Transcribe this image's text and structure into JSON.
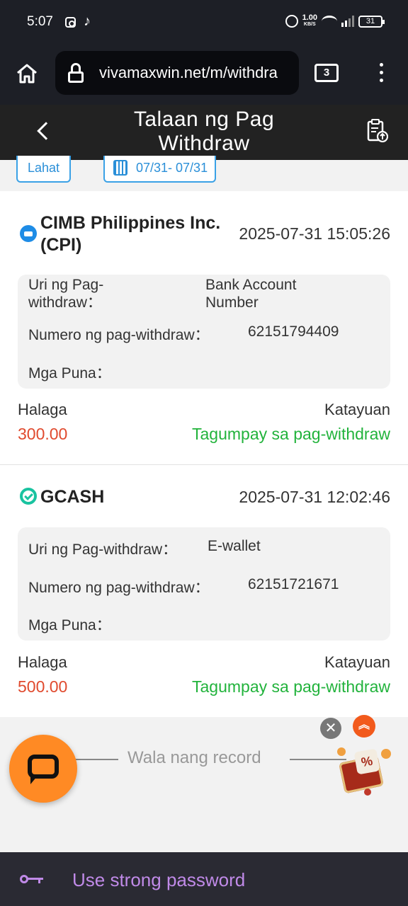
{
  "status_bar": {
    "time": "5:07",
    "net_speed": "1.00",
    "net_unit": "KB/S",
    "battery": "31"
  },
  "browser": {
    "url": "vivamaxwin.net/m/withdra",
    "tab_count": "3"
  },
  "header": {
    "title": "Talaan ng Pag Withdraw"
  },
  "filters": {
    "all_label": "Lahat",
    "date_range": "07/31- 07/31"
  },
  "records": [
    {
      "bank": "CIMB Philippines Inc. (CPI)",
      "datetime": "2025-07-31 15:05:26",
      "type_label": "Uri ng Pag-withdraw：",
      "type_value": "Bank Account Number",
      "number_label": "Numero ng pag-withdraw：",
      "number_value": "62151794409",
      "remarks_label": "Mga Puna：",
      "amount_label": "Halaga",
      "amount": "300.00",
      "status_label": "Katayuan",
      "status": "Tagumpay sa pag-withdraw"
    },
    {
      "bank": "GCASH",
      "datetime": "2025-07-31 12:02:46",
      "type_label": "Uri ng Pag-withdraw：",
      "type_value": "E-wallet",
      "number_label": "Numero ng pag-withdraw：",
      "number_value": "62151721671",
      "remarks_label": "Mga Puna：",
      "amount_label": "Halaga",
      "amount": "500.00",
      "status_label": "Katayuan",
      "status": "Tagumpay sa pag-withdraw"
    }
  ],
  "footer": {
    "no_more_records": "Wala nang record",
    "close_symbol": "✕",
    "up_symbol": "︽",
    "promo_symbol": "%"
  },
  "password_bar": {
    "label": "Use strong password"
  },
  "colors": {
    "accent_blue": "#2a8fd8",
    "amount_red": "#e04a2e",
    "success_green": "#22b33c",
    "chat_orange": "#ff8a24",
    "password_purple": "#c08ae8"
  },
  "icons": {
    "status": [
      "alarm-icon",
      "wifi-icon",
      "signal-icon",
      "battery-icon",
      "instagram-icon",
      "tiktok-icon"
    ],
    "browser": [
      "home-icon",
      "lock-icon",
      "tabs-icon",
      "menu-icon"
    ],
    "header": [
      "back-arrow-icon",
      "clipboard-upload-icon"
    ],
    "other": [
      "calendar-icon",
      "cimb-logo-icon",
      "gcash-logo-icon",
      "chat-icon",
      "close-icon",
      "scroll-up-icon",
      "promo-gift-icon",
      "key-icon"
    ]
  }
}
